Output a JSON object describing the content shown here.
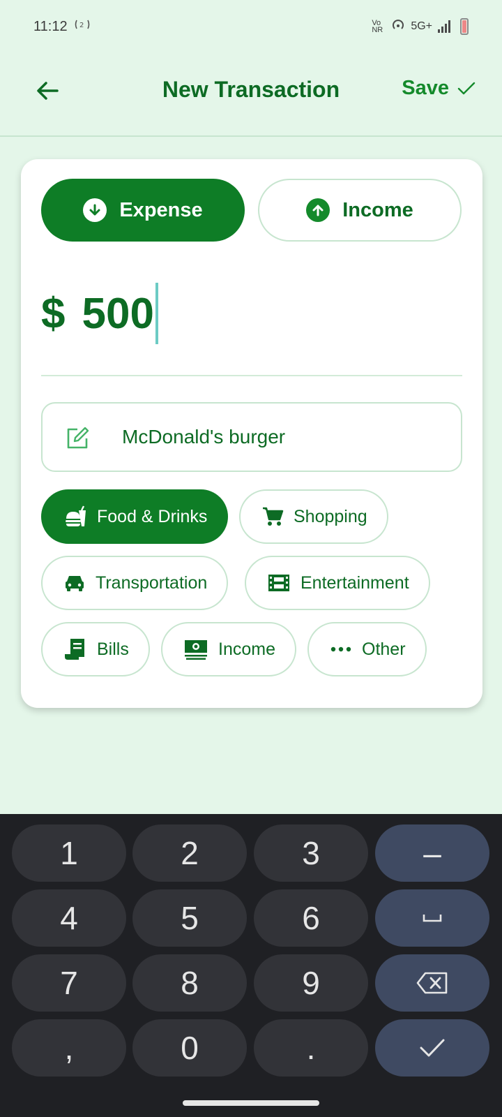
{
  "status_bar": {
    "time": "11:12",
    "network": "5G+",
    "vo_label": "Vo NR"
  },
  "header": {
    "title": "New Transaction",
    "save_label": "Save"
  },
  "type_toggle": {
    "expense_label": "Expense",
    "income_label": "Income",
    "selected": "Expense"
  },
  "amount": {
    "currency": "$",
    "value": "500"
  },
  "note": {
    "value": "McDonald's burger"
  },
  "categories": {
    "food": "Food & Drinks",
    "shopping": "Shopping",
    "transportation": "Transportation",
    "entertainment": "Entertainment",
    "bills": "Bills",
    "income": "Income",
    "other": "Other",
    "selected": "Food & Drinks"
  },
  "keyboard": {
    "k1": "1",
    "k2": "2",
    "k3": "3",
    "k4": "4",
    "k5": "5",
    "k6": "6",
    "k7": "7",
    "k8": "8",
    "k9": "9",
    "k0": "0",
    "comma": ",",
    "period": ".",
    "minus": "–"
  },
  "colors": {
    "background": "#E4F6E9",
    "accent": "#0E7D26",
    "keyboard_bg": "#1F2024"
  }
}
